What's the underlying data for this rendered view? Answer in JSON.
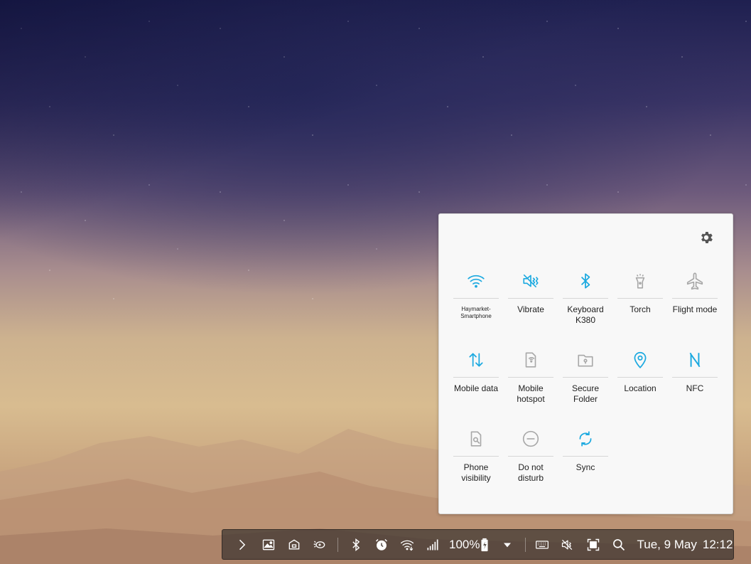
{
  "quick_panel": {
    "settings_icon": "gear-icon",
    "tiles": [
      {
        "label": "Haymarket-Smartphone",
        "icon": "wifi-icon",
        "active": true
      },
      {
        "label": "Vibrate",
        "icon": "vibrate-icon",
        "active": true
      },
      {
        "label": "Keyboard K380",
        "icon": "bluetooth-icon",
        "active": true
      },
      {
        "label": "Torch",
        "icon": "torch-icon",
        "active": false
      },
      {
        "label": "Flight mode",
        "icon": "airplane-icon",
        "active": false
      },
      {
        "label": "Mobile data",
        "icon": "mobile-data-icon",
        "active": true
      },
      {
        "label": "Mobile hotspot",
        "icon": "hotspot-icon",
        "active": false
      },
      {
        "label": "Secure Folder",
        "icon": "secure-folder-icon",
        "active": false
      },
      {
        "label": "Location",
        "icon": "location-icon",
        "active": true
      },
      {
        "label": "NFC",
        "icon": "nfc-icon",
        "active": true
      },
      {
        "label": "Phone visibility",
        "icon": "phone-visibility-icon",
        "active": false
      },
      {
        "label": "Do not disturb",
        "icon": "do-not-disturb-icon",
        "active": false
      },
      {
        "label": "Sync",
        "icon": "sync-icon",
        "active": true
      }
    ],
    "colors": {
      "active": "#1ba9e0",
      "inactive": "#a8a8a8"
    }
  },
  "taskbar": {
    "battery": "100%",
    "date": "Tue, 9 May",
    "time": "12:12"
  }
}
